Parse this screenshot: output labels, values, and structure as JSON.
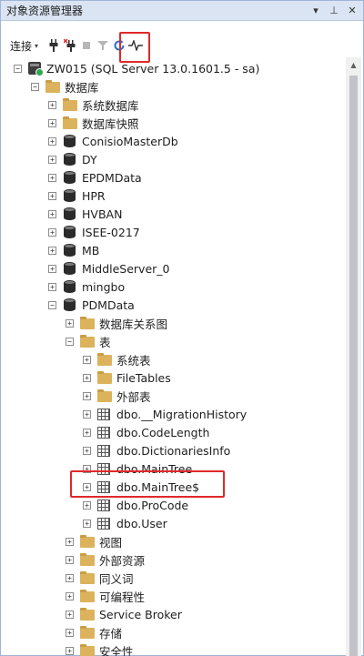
{
  "panel": {
    "title": "对象资源管理器",
    "pin_glyph": "▾",
    "autohide_glyph": "⊥",
    "close_glyph": "✕"
  },
  "toolbar": {
    "connect_label": "连接",
    "connect_arrow": "▾"
  },
  "tree": [
    {
      "id": "server",
      "level": 0,
      "expander": "−",
      "icon": "server",
      "label": "ZW015 (SQL Server 13.0.1601.5 - sa)"
    },
    {
      "id": "databases",
      "level": 1,
      "expander": "−",
      "icon": "folder",
      "label": "数据库"
    },
    {
      "id": "system-databases",
      "level": 2,
      "expander": "+",
      "icon": "folder",
      "label": "系统数据库"
    },
    {
      "id": "database-snapshots",
      "level": 2,
      "expander": "+",
      "icon": "folder",
      "label": "数据库快照"
    },
    {
      "id": "db-conisiomasterdb",
      "level": 2,
      "expander": "+",
      "icon": "db",
      "label": "ConisioMasterDb"
    },
    {
      "id": "db-dy",
      "level": 2,
      "expander": "+",
      "icon": "db",
      "label": "DY"
    },
    {
      "id": "db-epdmdata",
      "level": 2,
      "expander": "+",
      "icon": "db",
      "label": "EPDMData"
    },
    {
      "id": "db-hpr",
      "level": 2,
      "expander": "+",
      "icon": "db",
      "label": "HPR"
    },
    {
      "id": "db-hvban",
      "level": 2,
      "expander": "+",
      "icon": "db",
      "label": "HVBAN"
    },
    {
      "id": "db-isee-0217",
      "level": 2,
      "expander": "+",
      "icon": "db",
      "label": "ISEE-0217"
    },
    {
      "id": "db-mb",
      "level": 2,
      "expander": "+",
      "icon": "db",
      "label": "MB"
    },
    {
      "id": "db-middleserver-0",
      "level": 2,
      "expander": "+",
      "icon": "db",
      "label": "MiddleServer_0"
    },
    {
      "id": "db-mingbo",
      "level": 2,
      "expander": "+",
      "icon": "db",
      "label": "mingbo"
    },
    {
      "id": "db-pdmdata",
      "level": 2,
      "expander": "−",
      "icon": "db",
      "label": "PDMData"
    },
    {
      "id": "database-diagrams",
      "level": 3,
      "expander": "+",
      "icon": "folder",
      "label": "数据库关系图"
    },
    {
      "id": "tables",
      "level": 3,
      "expander": "−",
      "icon": "folder",
      "label": "表"
    },
    {
      "id": "system-tables",
      "level": 4,
      "expander": "+",
      "icon": "folder",
      "label": "系统表"
    },
    {
      "id": "filetables",
      "level": 4,
      "expander": "+",
      "icon": "folder",
      "label": "FileTables"
    },
    {
      "id": "external-tables",
      "level": 4,
      "expander": "+",
      "icon": "folder",
      "label": "外部表"
    },
    {
      "id": "table-migrationhistory",
      "level": 4,
      "expander": "+",
      "icon": "table",
      "label": "dbo.__MigrationHistory"
    },
    {
      "id": "table-codelength",
      "level": 4,
      "expander": "+",
      "icon": "table",
      "label": "dbo.CodeLength"
    },
    {
      "id": "table-dictionariesinfo",
      "level": 4,
      "expander": "+",
      "icon": "table",
      "label": "dbo.DictionariesInfo"
    },
    {
      "id": "table-maintree",
      "level": 4,
      "expander": "+",
      "icon": "table",
      "label": "dbo.MainTree"
    },
    {
      "id": "table-maintree-dollar",
      "level": 4,
      "expander": "+",
      "icon": "table",
      "label": "dbo.MainTree$"
    },
    {
      "id": "table-procode",
      "level": 4,
      "expander": "+",
      "icon": "table",
      "label": "dbo.ProCode"
    },
    {
      "id": "table-user",
      "level": 4,
      "expander": "+",
      "icon": "table",
      "label": "dbo.User"
    },
    {
      "id": "views",
      "level": 3,
      "expander": "+",
      "icon": "folder",
      "label": "视图"
    },
    {
      "id": "external-resources",
      "level": 3,
      "expander": "+",
      "icon": "folder",
      "label": "外部资源"
    },
    {
      "id": "synonyms",
      "level": 3,
      "expander": "+",
      "icon": "folder",
      "label": "同义词"
    },
    {
      "id": "programmability",
      "level": 3,
      "expander": "+",
      "icon": "folder",
      "label": "可编程性"
    },
    {
      "id": "service-broker",
      "level": 3,
      "expander": "+",
      "icon": "folder",
      "label": "Service Broker"
    },
    {
      "id": "storage",
      "level": 3,
      "expander": "+",
      "icon": "folder",
      "label": "存储"
    },
    {
      "id": "security",
      "level": 3,
      "expander": "+",
      "icon": "folder",
      "label": "安全性"
    }
  ],
  "scrollbar": {
    "up_glyph": "▲"
  },
  "colors": {
    "highlight": "#e0292a",
    "refresh": "#1f6fd1"
  }
}
